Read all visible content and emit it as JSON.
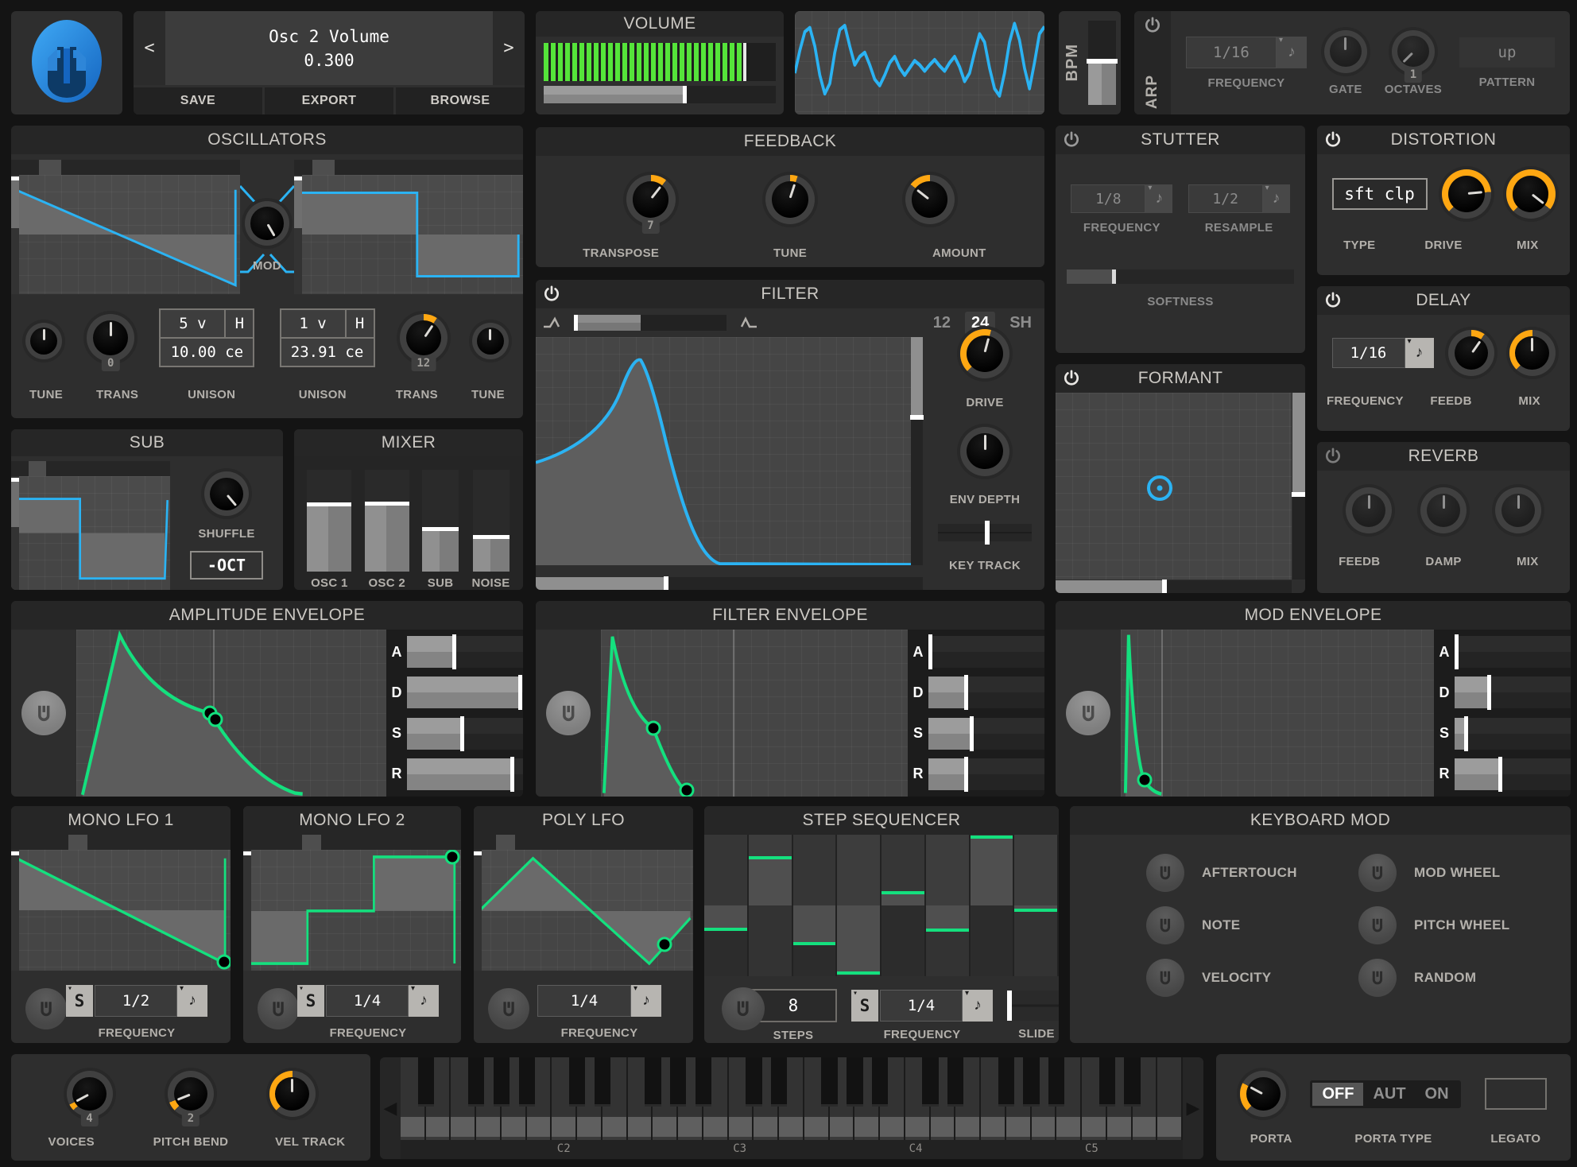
{
  "app": {
    "title_display": "Osc 2 Volume",
    "value_display": "0.300",
    "prev": "<",
    "next": ">",
    "save": "SAVE",
    "export": "EXPORT",
    "browse": "BROWSE"
  },
  "top": {
    "volume": {
      "title": "VOLUME"
    },
    "bpm_label": "BPM",
    "arp": {
      "label": "ARP",
      "frequency_value": "1/16",
      "frequency_label": "FREQUENCY",
      "gate_label": "GATE",
      "octaves_value": "1",
      "octaves_label": "OCTAVES",
      "pattern_value": "up",
      "pattern_label": "PATTERN"
    }
  },
  "oscillators": {
    "title": "OSCILLATORS",
    "mod_label": "MOD",
    "tune1_label": "TUNE",
    "trans1_label": "TRANS",
    "trans1_value": "0",
    "unison1": {
      "voices": "5 v",
      "harmonize": "H",
      "detune": "10.00 ce",
      "label": "UNISON"
    },
    "unison2": {
      "voices": "1 v",
      "harmonize": "H",
      "detune": "23.91 ce",
      "label": "UNISON"
    },
    "trans2_label": "TRANS",
    "trans2_value": "12",
    "tune2_label": "TUNE"
  },
  "sub": {
    "title": "SUB",
    "shuffle_label": "SHUFFLE",
    "octave_button": "-OCT"
  },
  "mixer": {
    "title": "MIXER",
    "channels": [
      {
        "label": "OSC 1",
        "value": 0.64
      },
      {
        "label": "OSC 2",
        "value": 0.65
      },
      {
        "label": "SUB",
        "value": 0.4
      },
      {
        "label": "NOISE",
        "value": 0.32
      }
    ]
  },
  "feedback": {
    "title": "FEEDBACK",
    "transpose_label": "TRANSPOSE",
    "transpose_value": "7",
    "tune_label": "TUNE",
    "amount_label": "AMOUNT"
  },
  "filter": {
    "title": "FILTER",
    "poles": [
      "12",
      "24",
      "SH"
    ],
    "selected_pole": "24",
    "drive_label": "DRIVE",
    "env_depth_label": "ENV DEPTH",
    "key_track_label": "KEY TRACK"
  },
  "stutter": {
    "title": "STUTTER",
    "frequency_value": "1/8",
    "frequency_label": "FREQUENCY",
    "resample_value": "1/2",
    "resample_label": "RESAMPLE",
    "softness_label": "SOFTNESS"
  },
  "formant": {
    "title": "FORMANT"
  },
  "distortion": {
    "title": "DISTORTION",
    "type_value": "sft clp",
    "type_label": "TYPE",
    "drive_label": "DRIVE",
    "mix_label": "MIX"
  },
  "delay": {
    "title": "DELAY",
    "frequency_value": "1/16",
    "frequency_label": "FREQUENCY",
    "feedb_label": "FEEDB",
    "mix_label": "MIX"
  },
  "reverb": {
    "title": "REVERB",
    "feedb_label": "FEEDB",
    "damp_label": "DAMP",
    "mix_label": "MIX"
  },
  "envelopes": {
    "labels": [
      "A",
      "D",
      "S",
      "R"
    ],
    "amp": {
      "title": "AMPLITUDE ENVELOPE",
      "a": 0.41,
      "d": 0.98,
      "s": 0.48,
      "r": 0.91
    },
    "filter": {
      "title": "FILTER ENVELOPE",
      "a": 0.02,
      "d": 0.33,
      "s": 0.38,
      "r": 0.33
    },
    "mod": {
      "title": "MOD ENVELOPE",
      "a": 0.02,
      "d": 0.3,
      "s": 0.1,
      "r": 0.4
    }
  },
  "lfo1": {
    "title": "MONO LFO 1",
    "sync": "S",
    "frequency_value": "1/2",
    "frequency_label": "FREQUENCY"
  },
  "lfo2": {
    "title": "MONO LFO 2",
    "sync": "S",
    "frequency_value": "1/4",
    "frequency_label": "FREQUENCY"
  },
  "poly_lfo": {
    "title": "POLY LFO",
    "frequency_value": "1/4",
    "frequency_label": "FREQUENCY"
  },
  "step_sequencer": {
    "title": "STEP SEQUENCER",
    "steps_value": "8",
    "steps_label": "STEPS",
    "sync": "S",
    "frequency_value": "1/4",
    "frequency_label": "FREQUENCY",
    "slide_label": "SLIDE",
    "step_values": [
      -0.32,
      0.65,
      -0.52,
      -0.93,
      0.16,
      -0.33,
      0.94,
      -0.04
    ]
  },
  "keyboard_mod": {
    "title": "KEYBOARD MOD",
    "items": [
      "AFTERTOUCH",
      "MOD WHEEL",
      "NOTE",
      "PITCH WHEEL",
      "VELOCITY",
      "RANDOM"
    ]
  },
  "bottom": {
    "voices_label": "VOICES",
    "voices_value": "4",
    "pitch_bend_label": "PITCH BEND",
    "pitch_bend_value": "2",
    "vel_track_label": "VEL TRACK",
    "octave_labels": [
      "C2",
      "C3",
      "C4",
      "C5"
    ],
    "porta_label": "PORTA",
    "porta_type_label": "PORTA TYPE",
    "porta_options": [
      "OFF",
      "AUT",
      "ON"
    ],
    "porta_selected": "OFF",
    "legato_label": "LEGATO"
  },
  "colors": {
    "accent_blue": "#2bb3f3",
    "accent_green": "#14e07e",
    "accent_orange": "#fea712",
    "meter_green": "#55e43a"
  }
}
